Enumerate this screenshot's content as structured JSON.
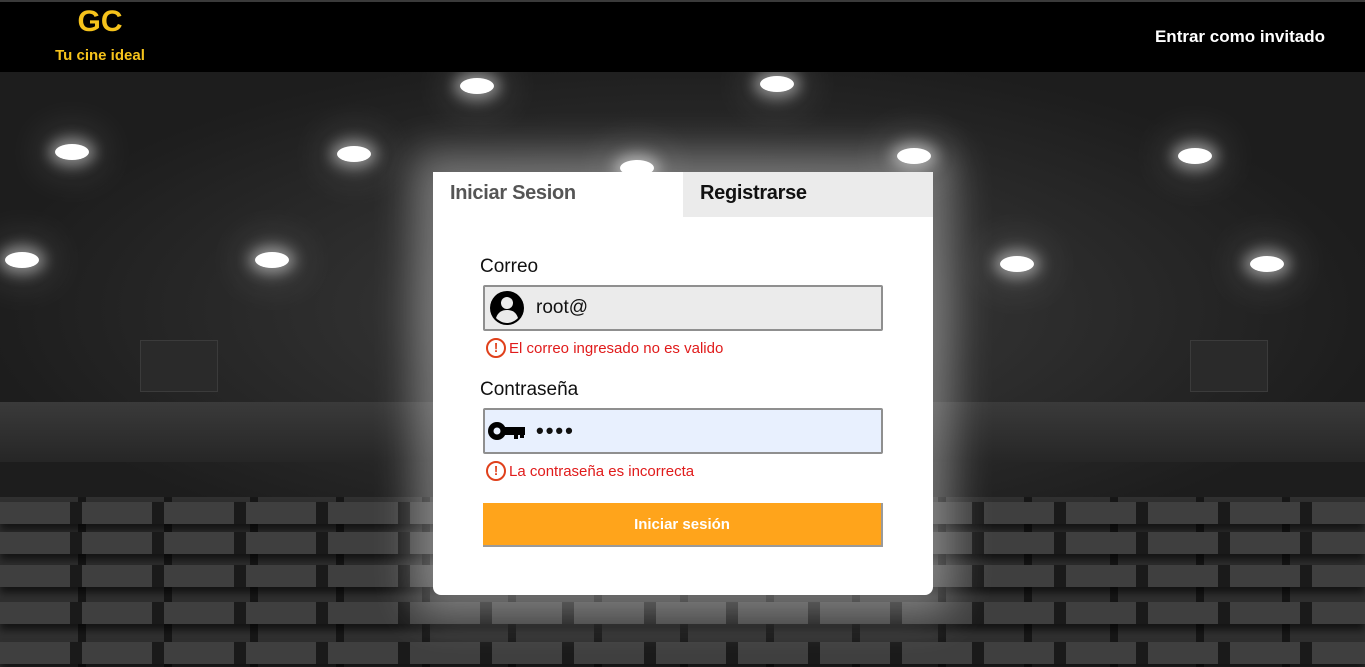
{
  "header": {
    "logo_mark": "GC",
    "tagline": "Tu cine ideal",
    "guest_link": "Entrar como invitado"
  },
  "tabs": {
    "login": "Iniciar Sesion",
    "register": "Registrarse"
  },
  "form": {
    "email_label": "Correo",
    "email_value": "root@",
    "email_error": "El correo ingresado no es valido",
    "password_label": "Contraseña",
    "password_value": "••••",
    "password_error": "La contraseña es incorrecta",
    "submit_label": "Iniciar sesión"
  },
  "icons": {
    "email": "user-circle-icon",
    "password": "key-icon",
    "error": "exclamation-circle-icon"
  },
  "colors": {
    "brand": "#f6c31b",
    "accent": "#ffa41b",
    "error": "#e01b1b"
  }
}
